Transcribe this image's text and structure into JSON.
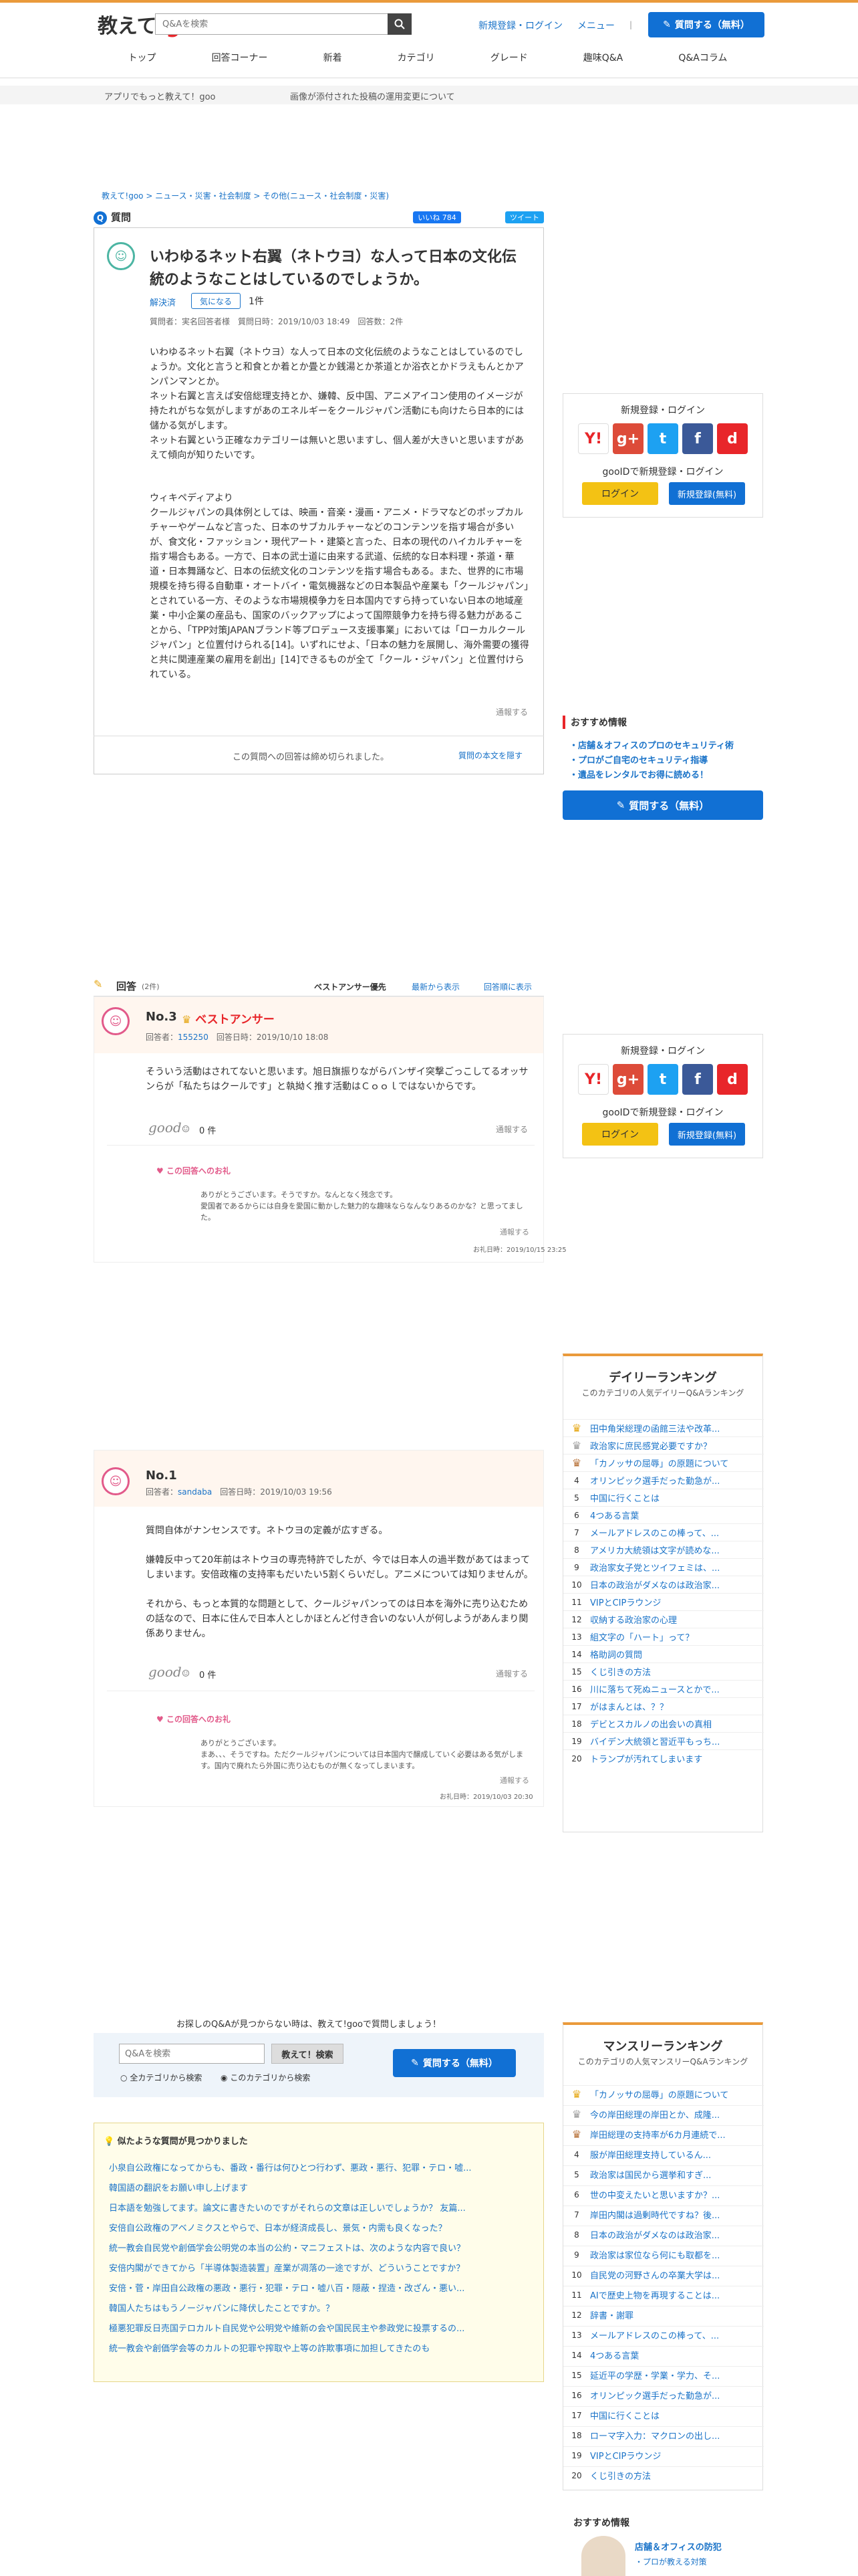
{
  "header": {
    "logo_prefix": "教えて!",
    "logo_brand": "goo",
    "search_placeholder": "Q&Aを検索",
    "login_link": "新規登録・ログイン",
    "menu_link": "メニュー",
    "ask_button": "質問する（無料）"
  },
  "nav": [
    "トップ",
    "回答コーナー",
    "新着",
    "カテゴリ",
    "グレード",
    "趣味Q&A",
    "Q&Aコラム"
  ],
  "notice": {
    "app": "アプリでもっと教えて！goo",
    "policy": "画像が添付された投稿の運用変更について"
  },
  "breadcrumb": "教えて!goo > ニュース・災害・社会制度 > その他(ニュース・社会制度・災害)",
  "question_section": {
    "label": "質問",
    "like": "いいね 784",
    "tweet": "ツイート"
  },
  "question": {
    "title": "いわゆるネット右翼（ネトウヨ）な人って日本の文化伝統のようなことはしているのでしょうか。",
    "status": "解決済",
    "watch_label": "気になる",
    "watch_count": "1件",
    "meta": "質問者：実名回答者様　質問日時：2019/10/03 18:49　回答数：2件",
    "body1": "いわゆるネット右翼（ネトウヨ）な人って日本の文化伝統のようなことはしているのでしょうか。文化と言うと和食とか着とか畳とか銭湯とか茶道とか浴衣とかドラえもんとかアンパンマンとか。\nネット右翼と言えば安倍総理支持とか、嫌韓、反中国、アニメアイコン使用のイメージが持たれがちな気がしますがあのエネルギーをクールジャパン活動にも向けたら日本的には儲かる気がします。\nネット右翼という正確なカテゴリーは無いと思いますし、個人差が大きいと思いますがあえて傾向が知りたいです。",
    "body2": "ウィキペディアより\nクールジャパンの具体例としては、映画・音楽・漫画・アニメ・ドラマなどのポップカルチャーやゲームなど言った、日本のサブカルチャーなどのコンテンツを指す場合が多いが、食文化・ファッション・現代アート・建築と言った、日本の現代のハイカルチャーを指す場合もある。一方で、日本の武士道に由来する武道、伝統的な日本料理・茶道・華道・日本舞踊など、日本の伝統文化のコンテンツを指す場合もある。また、世界的に市場規模を持ち得る自動車・オートバイ・電気機器などの日本製品や産業も「クールジャパン」とされている一方、そのような市場規模争力を日本国内ですら持っていない日本の地域産業・中小企業の産品も、国家のバックアップによって国際競争力を持ち得る魅力があることから、「TPP対策JAPANブランド等プロデュース支援事業」においては「ローカルクールジャパン」と位置付けられる[14]。いずれにせよ、「日本の魅力を展開し、海外需要の獲得と共に関連産業の雇用を創出」[14]できるものが全て「クール・ジャパン」と位置付けられている。",
    "report": "通報する",
    "closed": "この質問への回答は締め切られました。",
    "show_body": "質問の本文を隠す"
  },
  "sidebar": {
    "login_title": "新規登録・ログイン",
    "goo_login_title": "gooIDで新規登録・ログイン",
    "login_button": "ログイン",
    "register_button": "新規登録(無料)",
    "sns": [
      "Y!",
      "g+",
      "t",
      "f",
      "d"
    ],
    "recommend_head": "おすすめ情報",
    "recommend": [
      "店舗＆オフィスのプロのセキュリティ術",
      "プロがご自宅のセキュリティ指導",
      "遺品をレンタルでお得に読める！"
    ],
    "ask_button": "質問する（無料）"
  },
  "answers_header": {
    "label": "回答",
    "count": "(2件)",
    "sort_best": "ベストアンサー優先",
    "sort_new": "最新から表示",
    "sort_old": "回答順に表示"
  },
  "answers": [
    {
      "no": "No.3",
      "best": "ベストアンサー",
      "meta_prefix": "回答者：",
      "user": "155250",
      "date": "回答日時：2019/10/10 18:08",
      "body": "そういう活動はされてないと思います。旭日旗振りながらバンザイ突撃ごっこしてるオッサンらが「私たちはクールです」と執拗く推す活動はＣｏｏｌではないからです。",
      "good": "good",
      "good_count": "0 件",
      "report": "通報する",
      "thanks_head": "この回答へのお礼",
      "thanks": "ありがとうございます。そうですか。なんとなく残念です。\n愛国者であるからには自身を愛国に動かした魅力的な趣味ならなんなりあるのかな？と思ってました。",
      "thanks_report": "通報する",
      "thanks_date": "お礼日時：2019/10/15 23:25"
    },
    {
      "no": "No.1",
      "meta_prefix": "回答者：",
      "user": "sandaba",
      "date": "回答日時：2019/10/03 19:56",
      "body": "質問自体がナンセンスです。ネトウヨの定義が広すぎる。\n\n嫌韓反中って20年前はネトウヨの専売特許でしたが、今では日本人の過半数があてはまってしまいます。安倍政権の支持率もだいたい5割くらいだし。アニメについては知りませんが。\n\nそれから、もっと本質的な問題として、クールジャパンってのは日本を海外に売り込むための話なので、日本に住んで日本人としかほとんど付き合いのない人が何しようがあんまり関係ありません。",
      "good": "good",
      "good_count": "0 件",
      "report": "通報する",
      "thanks_head": "この回答へのお礼",
      "thanks": "ありがとうございます。\nまあ、、、そうですね。ただクールジャパンについては日本国内で醸成していく必要はある気がします。国内で廃れたら外国に売り込むものが無くなってしまいます。",
      "thanks_report": "通報する",
      "thanks_date": "お礼日時：2019/10/03 20:30"
    }
  ],
  "daily_ranking": {
    "title": "デイリーランキング",
    "sub": "このカテゴリの人気デイリーQ&Aランキング",
    "items": [
      "田中角栄総理の函館三法や改革...",
      "政治家に庶民感覚必要ですか？",
      "「カノッサの屈辱」の原題について",
      "オリンピック選手だった勤急が...",
      "中国に行くことは",
      "4つある言葉",
      "メールアドレスのこの棒って、...",
      "アメリカ大統領は文字が読めな...",
      "政治家女子党とツイフェミは、...",
      "日本の政治がダメなのは政治家...",
      "VIPとCIPラウンジ",
      "収納する政治家の心理",
      "組文字の「ハート」って？",
      "格助詞の質問",
      "くじ引きの方法",
      "川に落ちて死ぬニュースとかで...",
      "がはまんとは、？？",
      "デビとスカルノの出会いの真相",
      "バイデン大統領と習近平もっち...",
      "トランプが汚れてしまいます"
    ]
  },
  "bottom_search": {
    "lead": "お探しのQ&Aが見つからない時は、教えて!gooで質問しましょう！",
    "placeholder": "Q&Aを検索",
    "button": "教えて！検索",
    "radio_all": "全カテゴリから検索",
    "radio_cat": "このカテゴリから検索",
    "ask_button": "質問する（無料）"
  },
  "similar": {
    "head": "似たような質問が見つかりました",
    "items": [
      "小泉自公政権になってからも、番政・番行は何ひとつ行わず、悪政・悪行、犯罪・テロ・嘘...",
      "韓国語の翻訳をお願い申し上げます",
      "日本語を勉強してます。論文に書きたいのですがそれらの文章は正しいでしょうか？ 友篇...",
      "安倍自公政権のアベノミクスとやらで、日本が経済成長し、景気・内需も良くなった？",
      "統一教会自民党や創価学会公明党の本当の公約・マニフェストは、次のような内容で良い？",
      "安倍内閣ができてから「半導体製造装置」産業が凋落の一途ですが、どういうことですか？",
      "安倍・菅・岸田自公政権の悪政・悪行・犯罪・テロ・嘘八百・隠蔽・捏造・改ざん・悪い...",
      "韓国人たちはもうノージャパンに降伏したことですか。？",
      "極悪犯罪反日売国テロカルト自民党や公明党や維新の会や国民民主や参政党に投票するの...",
      "統一教会や創価学会等のカルトの犯罪や搾取や上等の詐欺事項に加担してきたのも"
    ]
  },
  "monthly_ranking": {
    "title": "マンスリーランキング",
    "sub": "このカテゴリの人気マンスリーQ&Aランキング",
    "items": [
      "「カノッサの屈辱」の原題について",
      "今の岸田総理の岸田とか、成隆...",
      "岸田総理の支持率が6カ月連続で...",
      "服が岸田総理支持しているん...",
      "政治家は国民から選挙和すぎ...",
      "世の中変えたいと思いますか？...",
      "岸田内閣は過剰時代ですね？後...",
      "日本の政治がダメなのは政治家...",
      "政治家は家位なら何にも取都を...",
      "自民党の河野さんの卒業大学は...",
      "AIで歴史上物を再現することは...",
      "辞書・謝罪",
      "メールアドレスのこの棒って、...",
      "4つある言葉",
      "延近平の学歴・学業・学力、そ...",
      "オリンピック選手だった勤急が...",
      "中国に行くことは",
      "ローマ字入力：マクロンの出し...",
      "VIPとCIPラウンジ",
      "くじ引きの方法"
    ]
  },
  "recommend_bottom": {
    "head": "おすすめ情報",
    "title": "店舗＆オフィスの防犯",
    "sub": "プロが教える対策"
  }
}
